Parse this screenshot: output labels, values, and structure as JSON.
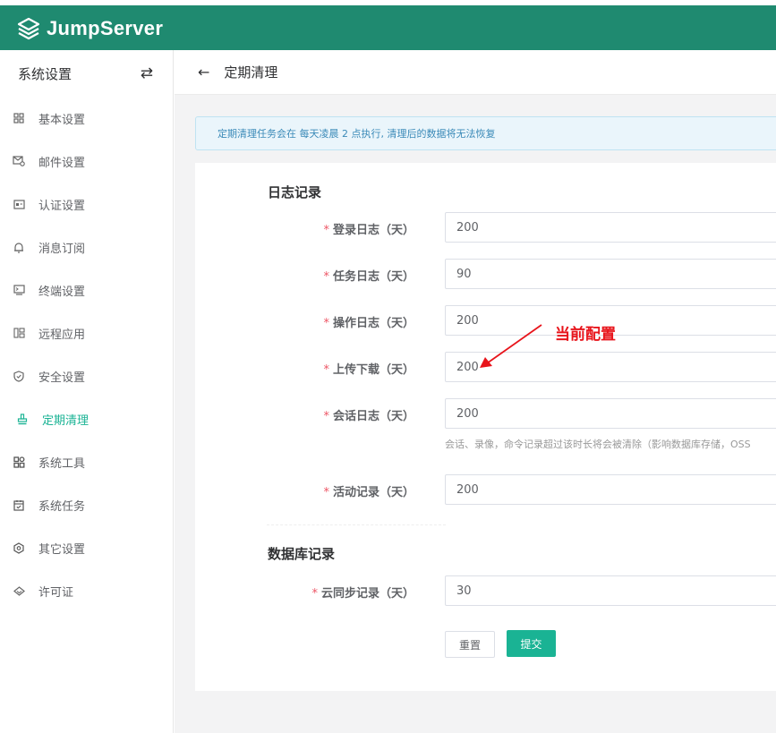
{
  "app": {
    "brand_name": "JumpServer",
    "brand_color": "#1f8a70",
    "accent_color": "#1ab394"
  },
  "sidebar": {
    "title": "系统设置",
    "toggle_icon": "swap-arrows-icon",
    "items": [
      {
        "label": "基本设置",
        "icon": "grid-icon"
      },
      {
        "label": "邮件设置",
        "icon": "mail-settings-icon"
      },
      {
        "label": "认证设置",
        "icon": "id-card-icon"
      },
      {
        "label": "消息订阅",
        "icon": "bell-icon"
      },
      {
        "label": "终端设置",
        "icon": "terminal-icon"
      },
      {
        "label": "远程应用",
        "icon": "apps-icon"
      },
      {
        "label": "安全设置",
        "icon": "shield-icon"
      },
      {
        "label": "定期清理",
        "icon": "broom-icon",
        "active": true
      },
      {
        "label": "系统工具",
        "icon": "tools-icon"
      },
      {
        "label": "系统任务",
        "icon": "calendar-task-icon"
      },
      {
        "label": "其它设置",
        "icon": "hexagon-settings-icon"
      },
      {
        "label": "许可证",
        "icon": "license-icon"
      }
    ]
  },
  "header": {
    "back_icon": "arrow-left-icon",
    "title": "定期清理"
  },
  "alert": {
    "text": "定期清理任务会在 每天凌晨 2 点执行, 清理后的数据将无法恢复"
  },
  "form": {
    "log_section_title": "日志记录",
    "db_section_title": "数据库记录",
    "required_mark": "*",
    "fields": {
      "login_log": {
        "label": "登录日志（天）",
        "value": "200"
      },
      "task_log": {
        "label": "任务日志（天）",
        "value": "90"
      },
      "operate_log": {
        "label": "操作日志（天）",
        "value": "200"
      },
      "ftp_log": {
        "label": "上传下载（天）",
        "value": "200"
      },
      "session_log": {
        "label": "会话日志（天）",
        "value": "200",
        "help": "会话、录像，命令记录超过该时长将会被清除（影响数据库存储，OSS"
      },
      "activity_log": {
        "label": "活动记录（天）",
        "value": "200"
      },
      "cloud_sync_log": {
        "label": "云同步记录（天）",
        "value": "30"
      }
    },
    "reset_label": "重置",
    "submit_label": "提交"
  },
  "annotation": {
    "text": "当前配置",
    "color": "#e8141b"
  }
}
